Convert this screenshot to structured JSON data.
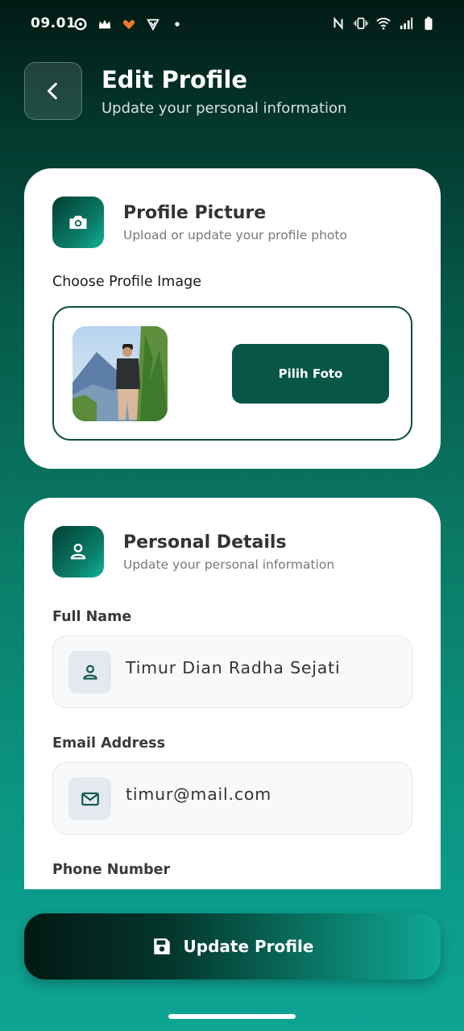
{
  "status_bar": {
    "time": "09.01",
    "left_icons": [
      "location-ring-icon",
      "crown-icon",
      "brand-heart-icon",
      "shield-v-icon",
      "dot-icon"
    ],
    "right_icons": [
      "nfc-icon",
      "vibrate-icon",
      "wifi-icon",
      "signal-icon",
      "battery-icon"
    ]
  },
  "header": {
    "title": "Edit Profile",
    "subtitle": "Update your personal information"
  },
  "profile_picture": {
    "title": "Profile Picture",
    "subtitle": "Upload or update your profile photo",
    "label": "Choose Profile Image",
    "button_label": "Pilih Foto"
  },
  "personal_details": {
    "title": "Personal Details",
    "subtitle": "Update your personal information",
    "fields": [
      {
        "label": "Full Name",
        "value": "Timur Dian Radha Sejati",
        "icon": "user-icon"
      },
      {
        "label": "Email Address",
        "value": "timur@mail.com",
        "icon": "mail-icon"
      },
      {
        "label": "Phone Number",
        "value": "",
        "icon": "phone-icon"
      }
    ]
  },
  "footer": {
    "update_label": "Update Profile"
  },
  "colors": {
    "primary": "#075646",
    "accent": "#0da494",
    "background_top": "#011a14"
  }
}
